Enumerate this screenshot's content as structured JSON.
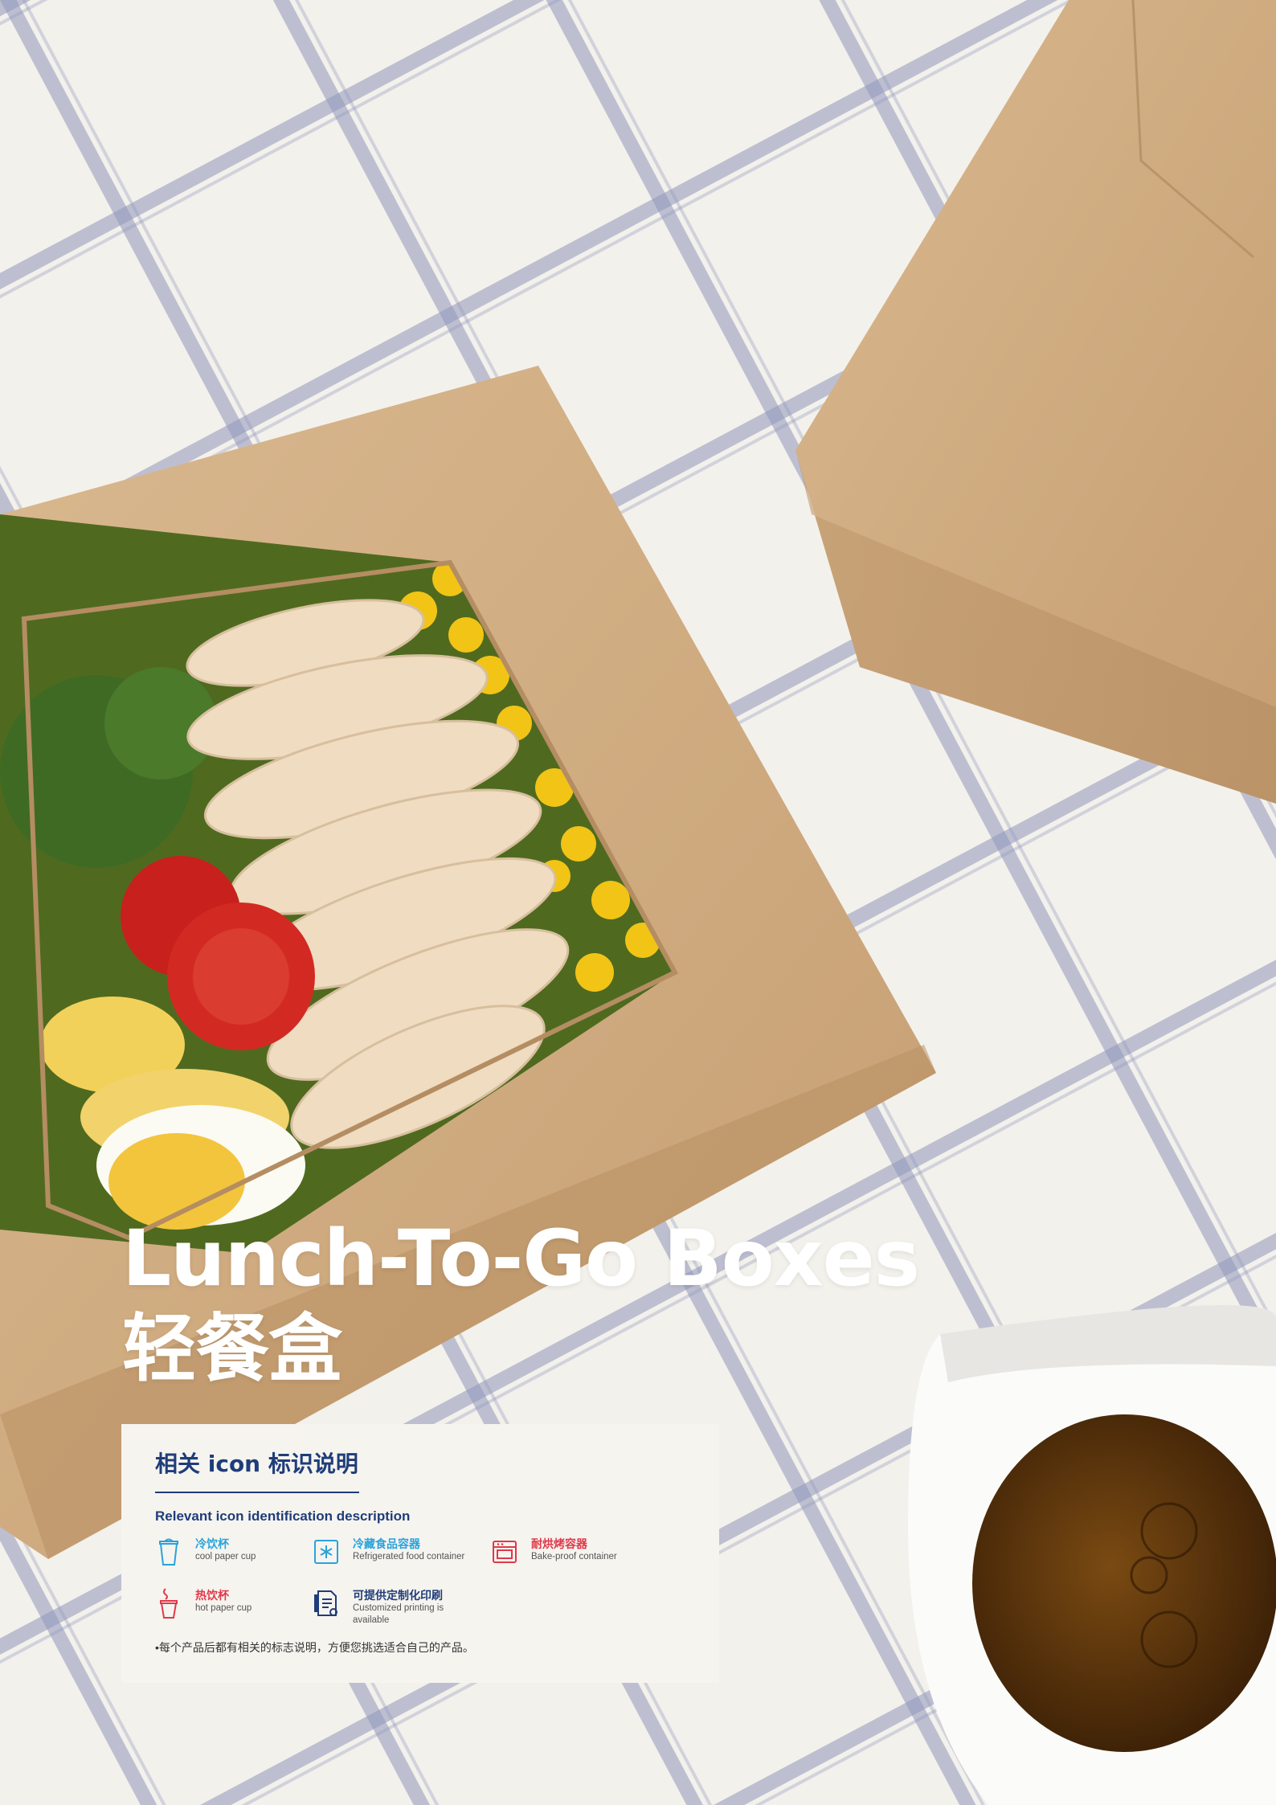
{
  "title": {
    "english": "Lunch-To-Go Boxes",
    "chinese": "轻餐盒"
  },
  "icon_panel": {
    "heading": "相关 icon 标识说明",
    "subheading": "Relevant icon identification description",
    "items": [
      {
        "cn": "冷饮杯",
        "en": "cool paper cup",
        "icon": "cold-cup-icon",
        "color": "#29a3dc"
      },
      {
        "cn": "冷藏食品容器",
        "en": "Refrigerated food container",
        "icon": "snowflake-box-icon",
        "color": "#29a3dc"
      },
      {
        "cn": "耐烘烤容器",
        "en": "Bake-proof container",
        "icon": "oven-icon",
        "color": "#e0384a"
      },
      {
        "cn": "热饮杯",
        "en": "hot paper cup",
        "icon": "hot-cup-icon",
        "color": "#e0384a"
      },
      {
        "cn": "可提供定制化印刷",
        "en": "Customized printing is available",
        "icon": "print-document-icon",
        "color": "#1f3d7a"
      }
    ],
    "note": "•每个产品后都有相关的标志说明，方便您挑选适合自己的产品。"
  },
  "colors": {
    "heading_blue": "#1f3d7a",
    "cold_blue": "#29a3dc",
    "hot_red": "#e0384a",
    "kraft": "#cfa97f",
    "cloth_check": "#6b73a6"
  }
}
